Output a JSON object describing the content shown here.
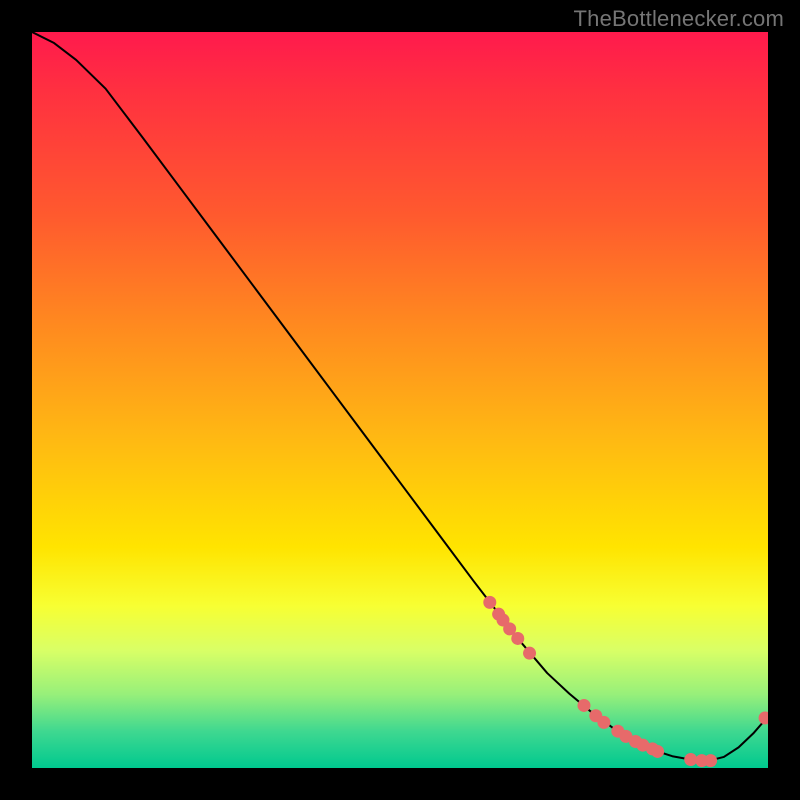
{
  "watermark": "TheBottlenecker.com",
  "chart_data": {
    "type": "line",
    "title": "",
    "xlabel": "",
    "ylabel": "",
    "xlim": [
      0,
      100
    ],
    "ylim": [
      0,
      100
    ],
    "grid": false,
    "legend": false,
    "series": [
      {
        "name": "curve",
        "style": "line",
        "color": "#000000",
        "x": [
          0,
          3,
          6,
          10,
          15,
          20,
          25,
          30,
          35,
          40,
          45,
          50,
          55,
          60,
          63,
          66,
          70,
          73,
          76,
          79,
          81,
          83,
          85,
          87,
          90,
          92,
          94,
          96,
          98,
          100
        ],
        "y": [
          100,
          98.5,
          96.2,
          92.3,
          85.7,
          79.0,
          72.3,
          65.6,
          58.9,
          52.2,
          45.5,
          38.8,
          32.1,
          25.4,
          21.5,
          17.6,
          12.9,
          10.1,
          7.6,
          5.4,
          4.1,
          3.1,
          2.25,
          1.6,
          1.05,
          1.0,
          1.5,
          2.8,
          4.7,
          7.0
        ]
      },
      {
        "name": "markers",
        "style": "scatter",
        "color": "#e76a6a",
        "x": [
          62.2,
          63.4,
          64.0,
          64.9,
          66.0,
          67.6,
          75.0,
          76.6,
          77.7,
          79.6,
          80.7,
          82.0,
          83.0,
          84.3,
          85.0,
          89.5,
          91.0,
          92.2,
          99.6
        ],
        "y": [
          22.5,
          20.9,
          20.1,
          18.9,
          17.6,
          15.6,
          8.5,
          7.1,
          6.2,
          5.0,
          4.3,
          3.6,
          3.1,
          2.6,
          2.25,
          1.15,
          1.0,
          1.0,
          6.8
        ]
      }
    ]
  }
}
